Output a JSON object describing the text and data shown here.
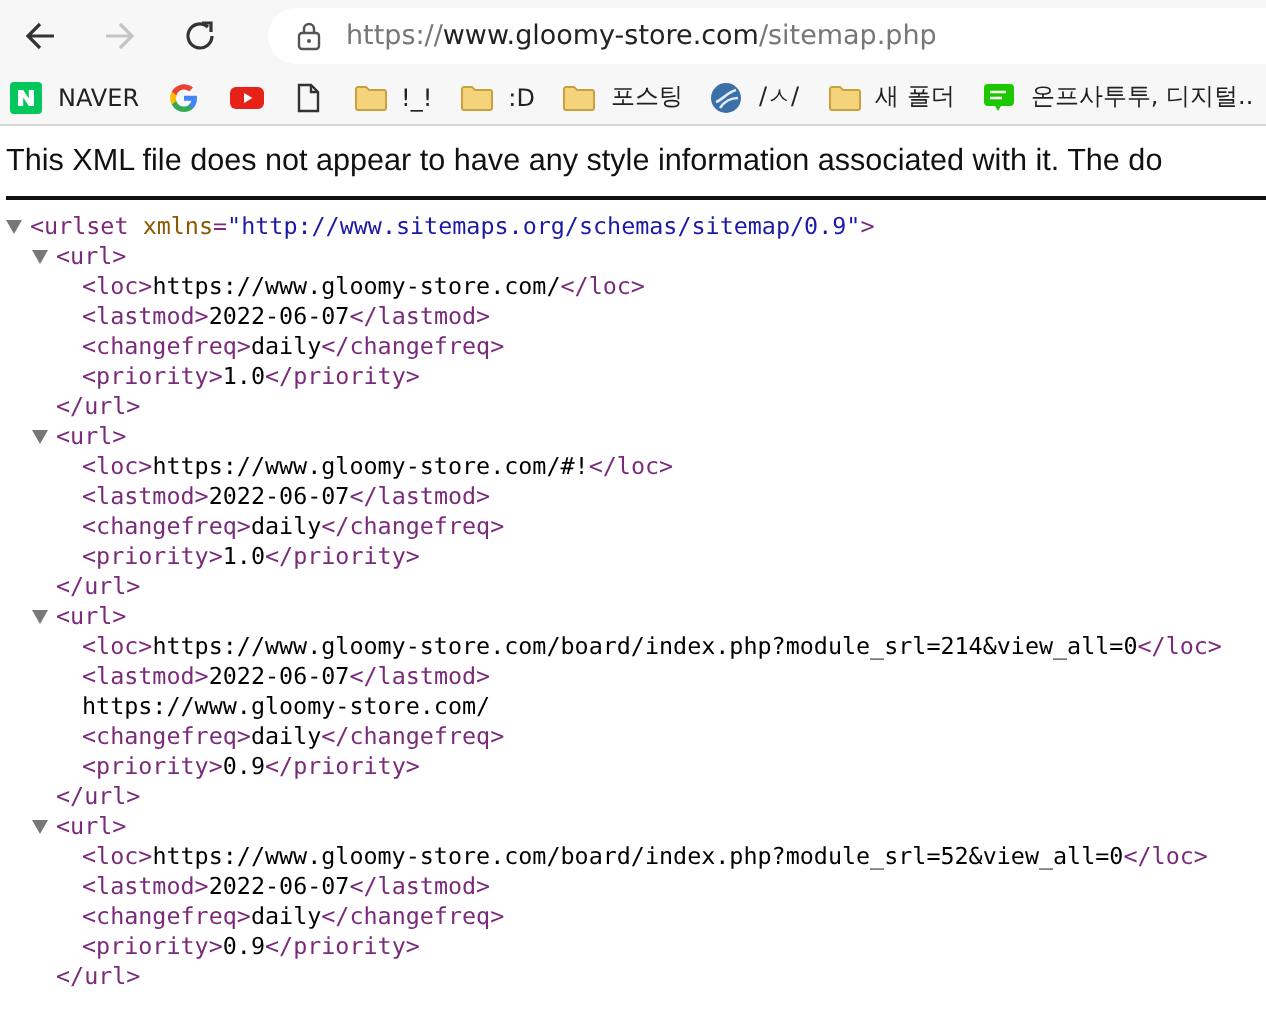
{
  "toolbar": {
    "back": {
      "disabled": false
    },
    "forward": {
      "disabled": true
    },
    "address": {
      "scheme": "https://",
      "host": "www.gloomy-store.com",
      "path": "/sitemap.php"
    }
  },
  "bookmarks": [
    {
      "kind": "naver",
      "label": "NAVER"
    },
    {
      "kind": "google"
    },
    {
      "kind": "youtube"
    },
    {
      "kind": "page"
    },
    {
      "kind": "folder",
      "label": "!_!"
    },
    {
      "kind": "folder",
      "label": ":D"
    },
    {
      "kind": "folder",
      "label": "포스팅"
    },
    {
      "kind": "globe",
      "label": "/ㅅ/"
    },
    {
      "kind": "folder",
      "label": "새 폴더"
    },
    {
      "kind": "blog",
      "label": "온프사투투, 디지털.."
    }
  ],
  "info_message": "This XML file does not appear to have any style information associated with it. The do",
  "xml_tree": {
    "kind": "element",
    "open": "<urlset",
    "attributes": [
      {
        "name": "xmlns",
        "equals": "=",
        "value": "\"http://www.sitemaps.org/schemas/sitemap/0.9\""
      }
    ],
    "open_end": ">",
    "expanded": true,
    "children": [
      {
        "kind": "element",
        "open": "<url>",
        "expanded": true,
        "close": "</url>",
        "children": [
          {
            "kind": "leaf",
            "open": "<loc>",
            "text": "https://www.gloomy-store.com/",
            "close": "</loc>"
          },
          {
            "kind": "leaf",
            "open": "<lastmod>",
            "text": "2022-06-07",
            "close": "</lastmod>"
          },
          {
            "kind": "leaf",
            "open": "<changefreq>",
            "text": "daily",
            "close": "</changefreq>"
          },
          {
            "kind": "leaf",
            "open": "<priority>",
            "text": "1.0",
            "close": "</priority>"
          }
        ]
      },
      {
        "kind": "element",
        "open": "<url>",
        "expanded": true,
        "close": "</url>",
        "children": [
          {
            "kind": "leaf",
            "open": "<loc>",
            "text": "https://www.gloomy-store.com/#!",
            "close": "</loc>"
          },
          {
            "kind": "leaf",
            "open": "<lastmod>",
            "text": "2022-06-07",
            "close": "</lastmod>"
          },
          {
            "kind": "leaf",
            "open": "<changefreq>",
            "text": "daily",
            "close": "</changefreq>"
          },
          {
            "kind": "leaf",
            "open": "<priority>",
            "text": "1.0",
            "close": "</priority>"
          }
        ]
      },
      {
        "kind": "element",
        "open": "<url>",
        "expanded": true,
        "close": "</url>",
        "children": [
          {
            "kind": "leaf",
            "open": "<loc>",
            "text": "https://www.gloomy-store.com/board/index.php?module_srl=214&view_all=0",
            "close": "</loc>"
          },
          {
            "kind": "leaf",
            "open": "<lastmod>",
            "text": "2022-06-07",
            "close": "</lastmod>"
          },
          {
            "kind": "text",
            "text": "https://www.gloomy-store.com/"
          },
          {
            "kind": "leaf",
            "open": "<changefreq>",
            "text": "daily",
            "close": "</changefreq>"
          },
          {
            "kind": "leaf",
            "open": "<priority>",
            "text": "0.9",
            "close": "</priority>"
          }
        ]
      },
      {
        "kind": "element",
        "open": "<url>",
        "expanded": true,
        "close": "</url>",
        "children": [
          {
            "kind": "leaf",
            "open": "<loc>",
            "text": "https://www.gloomy-store.com/board/index.php?module_srl=52&view_all=0",
            "close": "</loc>"
          },
          {
            "kind": "leaf",
            "open": "<lastmod>",
            "text": "2022-06-07",
            "close": "</lastmod>"
          },
          {
            "kind": "leaf",
            "open": "<changefreq>",
            "text": "daily",
            "close": "</changefreq>"
          },
          {
            "kind": "leaf",
            "open": "<priority>",
            "text": "0.9",
            "close": "</priority>"
          }
        ]
      }
    ]
  }
}
